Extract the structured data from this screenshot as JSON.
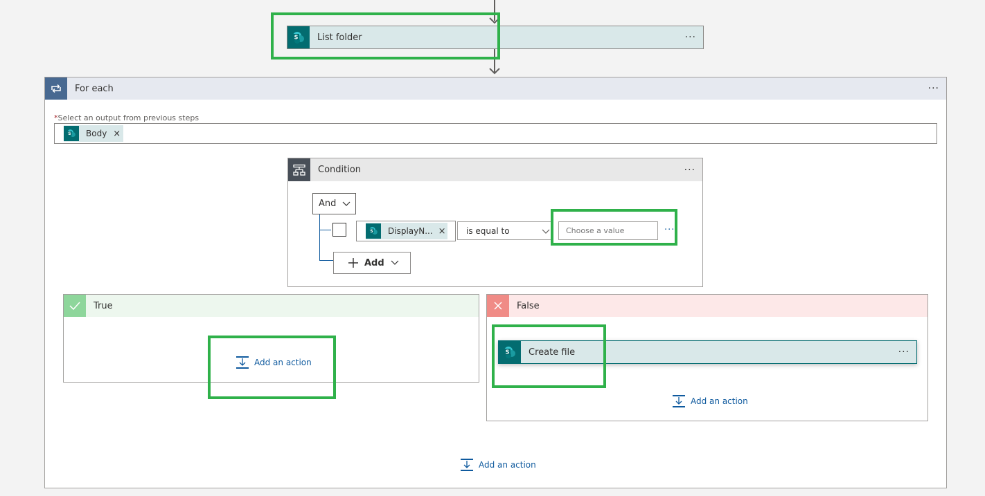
{
  "list_folder": {
    "title": "List folder",
    "more": "···"
  },
  "for_each": {
    "title": "For each",
    "more": "···",
    "required_mark": "*",
    "field_label": "Select an output from previous steps",
    "token_label": "Body",
    "token_remove": "×",
    "add_action": "Add an action"
  },
  "condition": {
    "title": "Condition",
    "more": "···",
    "group_operator": "And",
    "row": {
      "token_label": "DisplayN...",
      "token_remove": "×",
      "operator": "is equal to",
      "value_placeholder": "Choose a value",
      "more": "···"
    },
    "add_label": "Add"
  },
  "true_branch": {
    "title": "True",
    "add_action": "Add an action"
  },
  "false_branch": {
    "title": "False",
    "action_title": "Create file",
    "action_more": "···",
    "add_action": "Add an action"
  },
  "colors": {
    "sharepoint": "#036c70",
    "foreach_header": "#e6e9f0",
    "foreach_icon": "#486991",
    "condition_icon": "#484f58",
    "true_header": "#edf7ee",
    "true_icon": "#8ed69b",
    "false_header": "#fde8e8",
    "false_icon": "#f08b86",
    "action_header": "#d9e8e9",
    "highlight": "#2fb14a",
    "link": "#0f5a9e"
  }
}
